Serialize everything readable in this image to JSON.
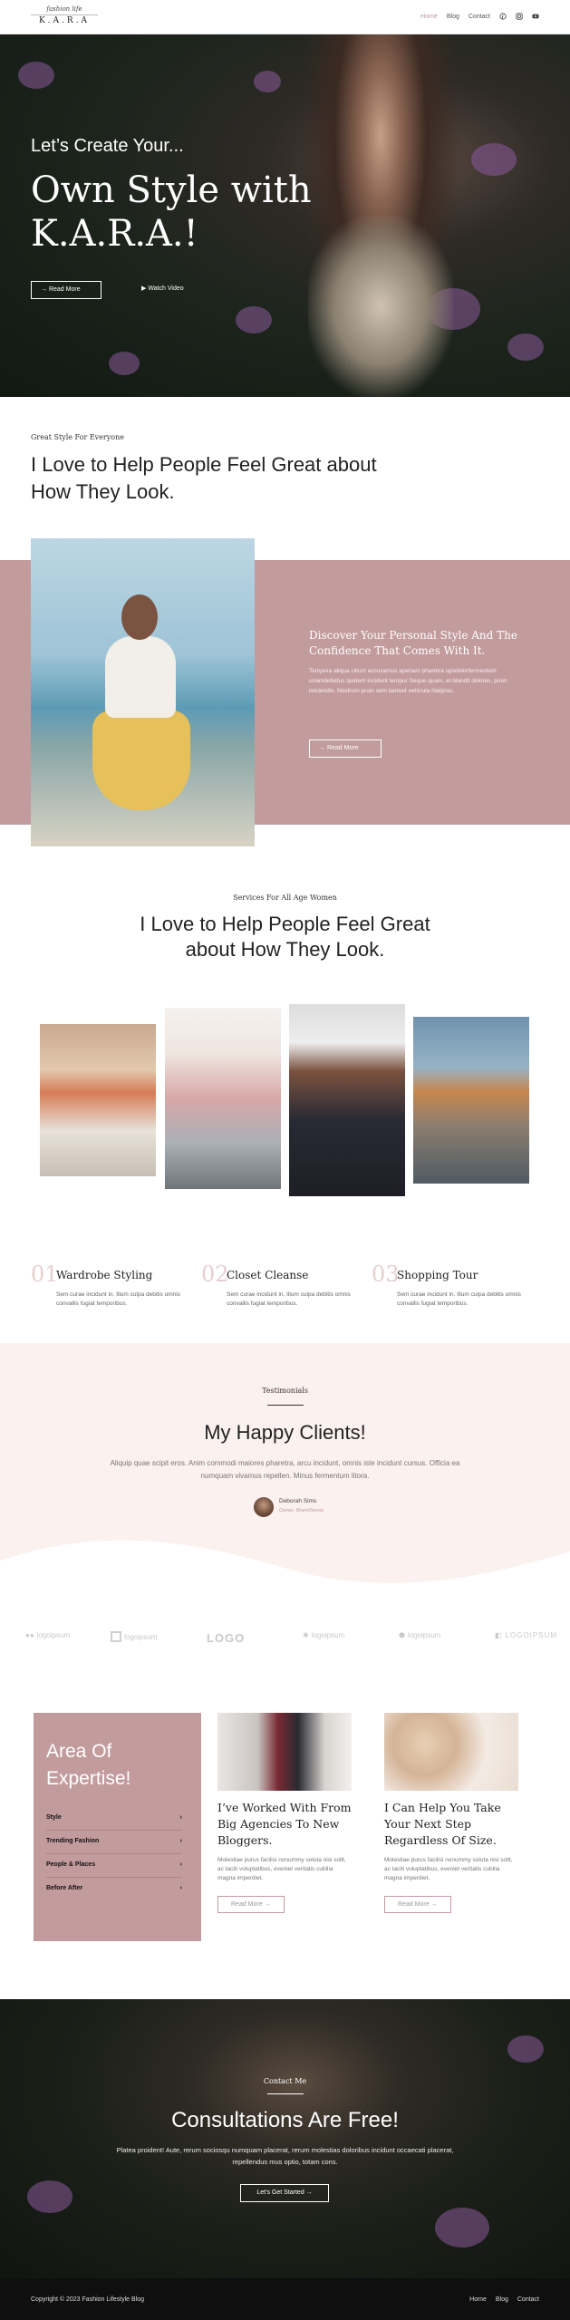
{
  "header": {
    "logo_script": "fashion life",
    "logo_brand": "K.A.R.A",
    "nav": [
      "Home",
      "Blog",
      "Contact"
    ],
    "icons": [
      "pinterest-icon",
      "instagram-icon",
      "youtube-icon"
    ]
  },
  "hero": {
    "subtitle": "Let’s Create Your...",
    "title_line1": "Own Style with",
    "title_line2": "K.A.R.A.!",
    "read_more": "Read More",
    "watch_video": "Watch Video"
  },
  "intro": {
    "kicker": "Great Style For Everyone",
    "title": "I Love to Help People Feel Great about How They Look."
  },
  "feature": {
    "title": "Discover Your Personal Style And The Confidence That Comes With It.",
    "text": "Tempora aliqua cillum accusamus aperiam pharetra upsdolorfermentum unamdebetus quidem incidunt tempor Seque quam, et blandit dolores, proin reiciendis. Nostrum proin sem laoreet vehicula hiatpras.",
    "read_more": "Read More"
  },
  "services": {
    "kicker": "Services For All Age Women",
    "title": "I Love to Help People Feel Great about How They Look."
  },
  "steps": [
    {
      "num": "01",
      "title": "Wardrobe Styling",
      "text": "Sem curae incidunt in. Illum culpa debitis omnis convallis fugiat temporibus."
    },
    {
      "num": "02",
      "title": "Closet Cleanse",
      "text": "Sem curae incidunt in. Illum culpa debitis omnis convallis fugiat temporibus."
    },
    {
      "num": "03",
      "title": "Shopping Tour",
      "text": "Sem curae incidunt in. Illum culpa debitis omnis convallis fugiat temporibus."
    }
  ],
  "testimonials": {
    "kicker": "Testimonials",
    "title": "My Happy Clients!",
    "quote": "Aliquip quae scipit eros. Anim commodi maiores pharetra, arcu incidunt, omnis iste incidunt cursus. Officia ea numquam vivamus repellen. Minus fermentum litora.",
    "name": "Deborah Sims",
    "role": "Owner, BrandSense"
  },
  "logos": [
    "logoipsum",
    "logoipsum",
    "LOGO",
    "logoipsum",
    "logoipsum",
    "LOGOIPSUM"
  ],
  "expertise": {
    "title": "Area Of Expertise!",
    "items": [
      "Style",
      "Trending Fashion",
      "People & Places",
      "Before After"
    ],
    "cards": [
      {
        "title": "I’ve Worked With From Big Agencies To New Bloggers.",
        "text": "Molestiae purus facilisi nonummy soluta nisi sollt, ac taciti voluptatibus, eveniet veritatis cubilia magna imperdiet.",
        "button": "Read More"
      },
      {
        "title": "I Can Help You Take Your Next Step Regardless Of Size.",
        "text": "Molestiae purus facilisi nonummy soluta nisi sollt, ac taciti voluptatibus, eveniet veritatis cubilia magna imperdiet.",
        "button": "Read More"
      }
    ]
  },
  "consult": {
    "kicker": "Contact Me",
    "title": "Consultations Are Free!",
    "text": "Platea proident! Aute, rerum sociosqu numquam placerat, rerum molestias doloribus incidunt occaecati placerat, repellendus mus optio, totam cons.",
    "button": "Let’s Get Started"
  },
  "footer": {
    "copy": "Copyright © 2023 Fashion Lifestyle Blog",
    "nav": [
      "Home",
      "Blog",
      "Contact"
    ]
  },
  "colors": {
    "accent": "#c29b9d",
    "blush": "#fbf1ef",
    "dark": "#111510"
  }
}
